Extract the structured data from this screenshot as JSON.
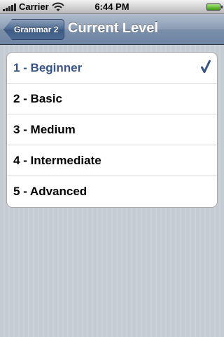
{
  "status_bar": {
    "carrier": "Carrier",
    "time": "6:44 PM"
  },
  "nav": {
    "back_label": "Grammar 2",
    "title": "Current Level"
  },
  "levels": [
    {
      "label": "1 - Beginner",
      "selected": true
    },
    {
      "label": "2 - Basic",
      "selected": false
    },
    {
      "label": "3 - Medium",
      "selected": false
    },
    {
      "label": "4 - Intermediate",
      "selected": false
    },
    {
      "label": "5 - Advanced",
      "selected": false
    }
  ],
  "colors": {
    "nav_bar": "#6d84a2",
    "selected_text": "#385487",
    "background": "#c5ccd4"
  },
  "icons": {
    "selected_marker": "checkmark-icon"
  }
}
